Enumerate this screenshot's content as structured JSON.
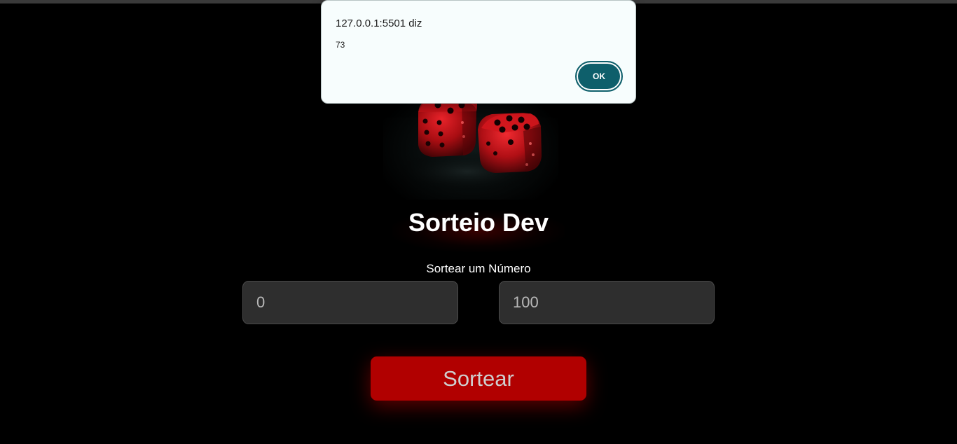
{
  "app": {
    "title": "Sorteio Dev",
    "subtitle": "Sortear um Número"
  },
  "inputs": {
    "min_value": "0",
    "max_value": "100"
  },
  "actions": {
    "draw_label": "Sortear"
  },
  "alert": {
    "origin": "127.0.0.1:5501 diz",
    "message": "73",
    "ok_label": "OK"
  },
  "colors": {
    "background": "#000000",
    "accent": "#b10000",
    "dialog_button": "#0e5f6b",
    "input_bg": "#2e2e2e"
  },
  "icons": {
    "hero_image": "red-dice-image"
  }
}
